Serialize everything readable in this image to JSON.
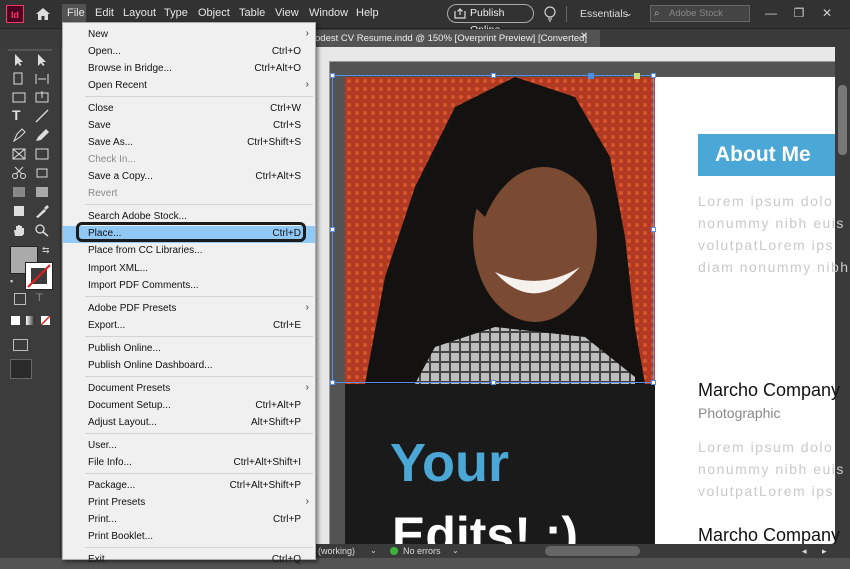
{
  "app": {
    "icon_label": "Id"
  },
  "menubar": {
    "items": [
      "File",
      "Edit",
      "Layout",
      "Type",
      "Object",
      "Table",
      "View",
      "Window",
      "Help"
    ],
    "publish_online": "Publish Online",
    "workspace": "Essentials",
    "search_placeholder": "Adobe Stock"
  },
  "document": {
    "tab_title": "odest CV Resume.indd @ 150% [Overprint Preview] [Converted]",
    "about_me": "About Me",
    "lorem_lines_1": [
      "Lorem ipsum dolo",
      "nonummy nibh euis",
      "volutpatLorem ips",
      "diam nonummy nibh"
    ],
    "company_1": "Marcho Company",
    "photographic": "Photographic",
    "lorem_lines_2": [
      "Lorem ipsum dolo",
      "nonummy nibh euis",
      "volutpatLorem ips"
    ],
    "company_2": "Marcho Company",
    "your": "Your",
    "edits": "Edits! :)"
  },
  "statusbar": {
    "mode": "(working)",
    "errors": "No errors"
  },
  "file_menu": {
    "items": [
      {
        "label": "New",
        "shortcut": "",
        "submenu": true
      },
      {
        "label": "Open...",
        "shortcut": "Ctrl+O"
      },
      {
        "label": "Browse in Bridge...",
        "shortcut": "Ctrl+Alt+O"
      },
      {
        "label": "Open Recent",
        "shortcut": "",
        "submenu": true
      },
      {
        "label": "Close",
        "shortcut": "Ctrl+W"
      },
      {
        "label": "Save",
        "shortcut": "Ctrl+S"
      },
      {
        "label": "Save As...",
        "shortcut": "Ctrl+Shift+S"
      },
      {
        "label": "Check In...",
        "shortcut": "",
        "disabled": true
      },
      {
        "label": "Save a Copy...",
        "shortcut": "Ctrl+Alt+S"
      },
      {
        "label": "Revert",
        "shortcut": "",
        "disabled": true
      },
      {
        "label": "Search Adobe Stock...",
        "shortcut": ""
      },
      {
        "label": "Place...",
        "shortcut": "Ctrl+D",
        "highlighted": true
      },
      {
        "label": "Place from CC Libraries...",
        "shortcut": ""
      },
      {
        "label": "Import XML...",
        "shortcut": ""
      },
      {
        "label": "Import PDF Comments...",
        "shortcut": ""
      },
      {
        "label": "Adobe PDF Presets",
        "shortcut": "",
        "submenu": true
      },
      {
        "label": "Export...",
        "shortcut": "Ctrl+E"
      },
      {
        "label": "Publish Online...",
        "shortcut": ""
      },
      {
        "label": "Publish Online Dashboard...",
        "shortcut": ""
      },
      {
        "label": "Document Presets",
        "shortcut": "",
        "submenu": true
      },
      {
        "label": "Document Setup...",
        "shortcut": "Ctrl+Alt+P"
      },
      {
        "label": "Adjust Layout...",
        "shortcut": "Alt+Shift+P"
      },
      {
        "label": "User...",
        "shortcut": ""
      },
      {
        "label": "File Info...",
        "shortcut": "Ctrl+Alt+Shift+I"
      },
      {
        "label": "Package...",
        "shortcut": "Ctrl+Alt+Shift+P"
      },
      {
        "label": "Print Presets",
        "shortcut": "",
        "submenu": true
      },
      {
        "label": "Print...",
        "shortcut": "Ctrl+P"
      },
      {
        "label": "Print Booklet...",
        "shortcut": ""
      },
      {
        "label": "Exit",
        "shortcut": "Ctrl+Q"
      }
    ]
  },
  "colors": {
    "accent_blue": "#4aa7d6",
    "menu_highlight": "#90c8f6",
    "app_pink": "#ff3366"
  }
}
